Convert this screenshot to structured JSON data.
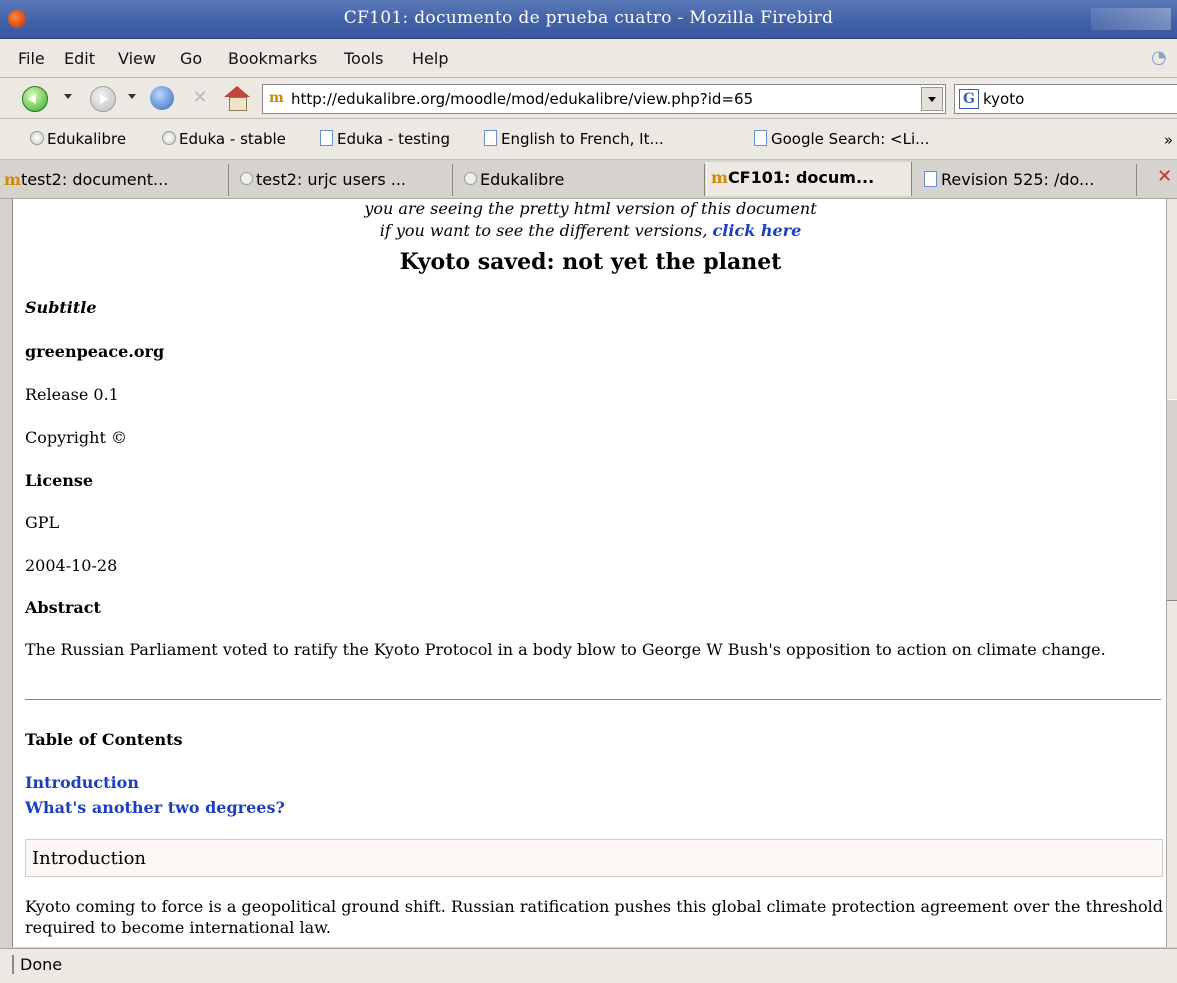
{
  "window": {
    "title": "CF101: documento de prueba cuatro - Mozilla Firebird"
  },
  "menu": [
    "File",
    "Edit",
    "View",
    "Go",
    "Bookmarks",
    "Tools",
    "Help"
  ],
  "nav": {
    "url": "http://edukalibre.org/moodle/mod/edukalibre/view.php?id=65",
    "search_value": "kyoto"
  },
  "bookmarks": [
    "Edukalibre",
    "Eduka - stable",
    "Eduka - testing",
    "English to French, It...",
    "Google Search: <Li..."
  ],
  "bookmarks_more": "»",
  "tabs": [
    "test2: document...",
    "test2: urjc users ...",
    "Edukalibre",
    "CF101: docum...",
    "Revision 525: /do..."
  ],
  "page": {
    "hint1": "you are seeing the pretty html version of this document",
    "hint2_prefix": "if you want to see the different versions,",
    "hint2_link": "click here",
    "title": "Kyoto saved: not yet the planet",
    "subtitle_label": "Subtitle",
    "org": "greenpeace.org",
    "release": "Release 0.1",
    "copyright": "Copyright ©",
    "license_label": "License",
    "license": "GPL",
    "date": "2004-10-28",
    "abstract_label": "Abstract",
    "abstract": "The Russian Parliament voted to ratify the Kyoto Protocol in a body blow to George W Bush's opposition to action on climate change.",
    "toc_label": "Table of Contents",
    "toc": [
      "Introduction",
      "What's another two degrees?"
    ],
    "section_heading": "Introduction",
    "section_text": "Kyoto coming to force is a geopolitical ground shift. Russian ratification pushes this global climate protection agreement over the threshold required to become international law."
  },
  "status": "Done"
}
